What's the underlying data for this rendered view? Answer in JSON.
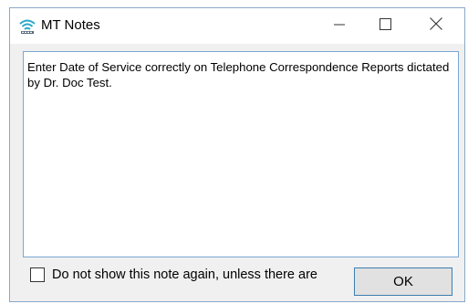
{
  "window": {
    "title": "MT Notes",
    "app_icon": "satellite-signal-icon",
    "controls": {
      "minimize_icon": "minimize-icon",
      "maximize_icon": "maximize-icon",
      "close_icon": "close-icon"
    }
  },
  "note": {
    "text": "Enter Date of Service correctly on Telephone Correspondence Reports dictated by Dr. Doc Test."
  },
  "footer": {
    "checkbox_label": "Do not show this note again, unless there are",
    "checkbox_checked": false,
    "ok_label": "OK"
  },
  "colors": {
    "accent_border": "#3c7fb1",
    "icon_teal": "#2aa7c9"
  }
}
